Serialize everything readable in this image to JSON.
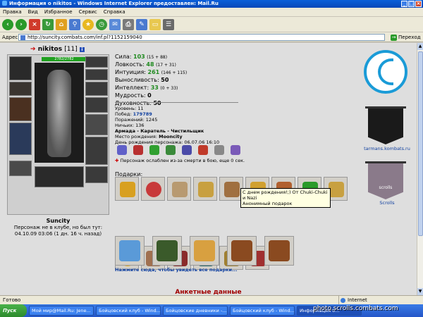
{
  "window": {
    "title": "Информация о nikitos - Windows Internet Explorer предоставлен: Mail.Ru"
  },
  "menu": [
    "Правка",
    "Вид",
    "Избранное",
    "Сервис",
    "Справка"
  ],
  "address": {
    "label": "Адрес:",
    "url": "http://suncity.combats.com/inf.pl?1152159040",
    "go_label": "Переход"
  },
  "character": {
    "name": "nikitos",
    "level": "[11]",
    "hp": "2782/2782",
    "city": "Suncity",
    "status_line1": "Персонаж не в клубе, но был тут:",
    "status_line2": "04.10.09 03:06 (1 дн. 16 ч. назад)"
  },
  "stats": [
    {
      "label": "Сила:",
      "value": "103",
      "extra": "(15 + 88)"
    },
    {
      "label": "Ловкость:",
      "value": "48",
      "extra": "(17 + 31)"
    },
    {
      "label": "Интуиция:",
      "value": "261",
      "extra": "(146 + 115)"
    },
    {
      "label": "Выносливость:",
      "value": "50",
      "extra": ""
    },
    {
      "label": "Интеллект:",
      "value": "33",
      "extra": "(0 + 33)"
    },
    {
      "label": "Мудрость:",
      "value": "0",
      "extra": ""
    },
    {
      "label": "Духовность:",
      "value": "50",
      "extra": ""
    }
  ],
  "info": {
    "level": "Уровень: 11",
    "wins_label": "Побед:",
    "wins": "179789",
    "losses": "Поражений: 1245",
    "draws": "Ничьих: 136",
    "army": "Армада - Каратель - Чистильщик",
    "birthplace_label": "Место рождения:",
    "birthplace": "Mooncity",
    "birthday": "День рождения персонажа: 06.07.06 16:10"
  },
  "weakened": "Персонаж ослаблен из-за смерти в бою, еще 0 сек.",
  "gifts_label": "Подарки:",
  "tooltip": {
    "line1": "С днем рождения!;) От Chuki-Chuki и Nazi",
    "line2": "Анонимный подарок"
  },
  "gifts_link": "Нажмите сюда, чтобы увидеть все подарки...",
  "personal_heading": "Анкетные данные",
  "clans": [
    {
      "name": "tarmans.kombats.ru"
    },
    {
      "name": "Scrolls",
      "banner_text": "scrolls"
    }
  ],
  "statusbar": {
    "left": "Готово",
    "zone": "Internet"
  },
  "taskbar": {
    "start": "Пуск",
    "tasks": [
      "Мой мир@Mail.Ru: Jene...",
      "Бойцовский клуб - Wind...",
      "Бойцовские дневники -...",
      "Бойцовский клуб - Wind...",
      "Информация о..."
    ]
  },
  "watermark": "photo.scrolls.combats.com"
}
